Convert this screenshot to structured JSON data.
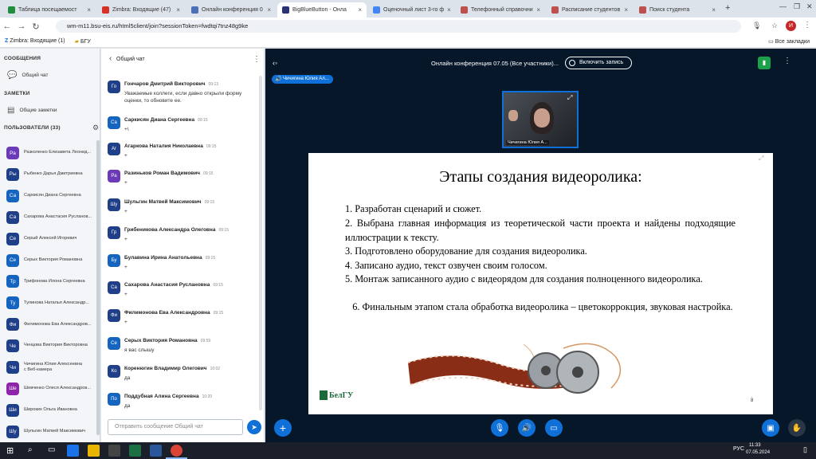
{
  "browser": {
    "tabs": [
      {
        "label": "Таблица посещаемост",
        "color": "#1e8e3e"
      },
      {
        "label": "Zimbra: Входящие (47)",
        "color": "#d93025"
      },
      {
        "label": "Онлайн конференция 0",
        "color": "#4b71b6"
      },
      {
        "label": "BigBlueButton - Онла",
        "color": "#283274",
        "active": true
      },
      {
        "label": "Оценочный лист 3-го ф",
        "color": "#4285f4"
      },
      {
        "label": "Телефонный справочни",
        "color": "#c0504d"
      },
      {
        "label": "Расписание студентов",
        "color": "#c0504d"
      },
      {
        "label": "Поиск студента",
        "color": "#c0504d"
      }
    ],
    "new_tab": "+",
    "url": "wm-m11.bsu-eis.ru/html5client/join?sessionToken=fwdtqi7tnz48g9ke",
    "bookmarks": [
      "Zimbra: Входящие (1)",
      "БГУ"
    ],
    "all_bookmarks": "Все закладки",
    "profile_initial": "И"
  },
  "sidebar": {
    "messages_header": "СООБЩЕНИЯ",
    "public_chat": "Общий чат",
    "notes_header": "ЗАМЕТКИ",
    "shared_notes": "Общие заметки",
    "users_header": "ПОЛЬЗОВАТЕЛИ (33)",
    "users": [
      {
        "initials": "Ра",
        "name": "Разколенко Елизавета Леонид...",
        "color": "#6a3ab7"
      },
      {
        "initials": "Ры",
        "name": "Рыбенко Дарья Дмитриевна",
        "color": "#1f3f88"
      },
      {
        "initials": "Са",
        "name": "Саркисян Диана Сергеевна",
        "color": "#1565c0"
      },
      {
        "initials": "Са",
        "name": "Сахарова Анастасия Русланов...",
        "color": "#1f3f88"
      },
      {
        "initials": "Се",
        "name": "Серый Алексей Игоревич",
        "color": "#1f3f88"
      },
      {
        "initials": "Се",
        "name": "Серых Виктория Романовна",
        "color": "#1565c0"
      },
      {
        "initials": "Тр",
        "name": "Трифонова Илона Сергеевна",
        "color": "#1565c0"
      },
      {
        "initials": "Ту",
        "name": "Тулинова Наталья Александр...",
        "color": "#1565c0"
      },
      {
        "initials": "Фи",
        "name": "Филимонова Ева Александров...",
        "color": "#1f3f88"
      },
      {
        "initials": "Че",
        "name": "Ченцова Виктория Викторовна",
        "color": "#1f3f88"
      },
      {
        "initials": "Чи",
        "name": "Чичигина Юлия Алексеевна",
        "name2": "с Веб-камера",
        "color": "#1f3f88"
      },
      {
        "initials": "Ше",
        "name": "Шевченко Олеся Александров...",
        "color": "#8e24aa"
      },
      {
        "initials": "Ши",
        "name": "Широких Ольга Ивановна",
        "color": "#1f3f88"
      },
      {
        "initials": "Шу",
        "name": "Шульгин Матвей Максимович",
        "color": "#1f3f88"
      }
    ]
  },
  "chat": {
    "back_label": "‹",
    "title": "Общий чат",
    "messages": [
      {
        "initials": "Го",
        "name": "Гончаров Дмитрий Викторович",
        "time": "09:13",
        "text": "Уважаемые коллеги, если давно открыли форму оценки, то обновите ее.",
        "color": "#1f3f88"
      },
      {
        "initials": "Са",
        "name": "Саркисян Диана Сергеевна",
        "time": "09:15",
        "text": "+\\",
        "color": "#1565c0"
      },
      {
        "initials": "Аг",
        "name": "Агаркова Наталия Николаевна",
        "time": "09:15",
        "text": "+",
        "color": "#1f3f88"
      },
      {
        "initials": "Ра",
        "name": "Разиньков Роман Вадимович",
        "time": "09:15",
        "text": "+",
        "color": "#6a3ab7"
      },
      {
        "initials": "Шу",
        "name": "Шульгин Матвей Максимович",
        "time": "09:15",
        "text": "+",
        "color": "#1f3f88"
      },
      {
        "initials": "Гр",
        "name": "Грибеникова Александра Олеговна",
        "time": "09:15",
        "text": "+",
        "color": "#1f3f88"
      },
      {
        "initials": "Бу",
        "name": "Булавина Ирина Анатольевна",
        "time": "09:15",
        "text": "+",
        "color": "#1565c0"
      },
      {
        "initials": "Са",
        "name": "Сахарова Анастасия Руслановна",
        "time": "09:15",
        "text": "+",
        "color": "#1f3f88"
      },
      {
        "initials": "Фи",
        "name": "Филимонова Ева Александровна",
        "time": "09:15",
        "text": "+",
        "color": "#1f3f88"
      },
      {
        "initials": "Се",
        "name": "Серых Виктория Романовна",
        "time": "09:59",
        "text": "я вас слышу",
        "color": "#1565c0"
      },
      {
        "initials": "Ко",
        "name": "Коренюгин Владимир Олегович",
        "time": "10:02",
        "text": "да",
        "color": "#1f3f88"
      },
      {
        "initials": "По",
        "name": "Поддубная Алина Сергеевна",
        "time": "10:20",
        "text": "да",
        "color": "#1565c0"
      }
    ],
    "input_placeholder": "Отправить сообщение Общий чат"
  },
  "meeting": {
    "title": "Онлайн конференция 07.05 (Все участники)...",
    "record_label": "Включить запись",
    "speaker": "Чичигина Юлия Ал...",
    "webcam_label": "Чичигина Юлия А...",
    "accent": "#0f70d7"
  },
  "slide": {
    "title": "Этапы создания видеоролика:",
    "items": [
      "1. Разработан сценарий и сюжет.",
      "2.  Выбрана главная информация из теоретической части проекта и найдены подходящие иллюстрации к тексту.",
      "3. Подготовлено оборудование для создания видеоролика.",
      "4. Записано аудио, текст озвучен своим голосом.",
      "5. Монтаж записанного аудио с видеорядом для создания полноценного видеоролика.",
      "   6. Финальным этапом стала обработка видеоролика – цветокоррокция, звуковая настройка."
    ],
    "logo_text": "БелГУ",
    "page_number": "8"
  },
  "taskbar": {
    "time": "11:33",
    "date": "07.05.2024",
    "lang": "РУС"
  }
}
